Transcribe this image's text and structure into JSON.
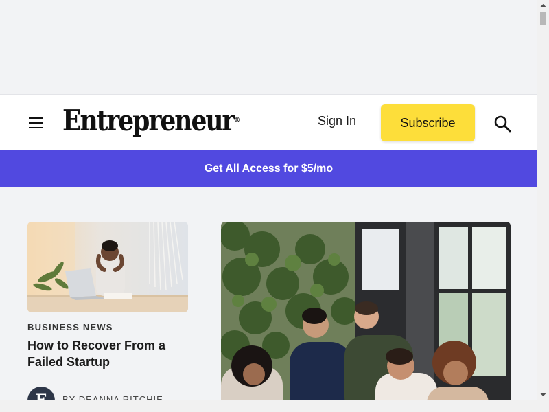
{
  "header": {
    "menu_icon": "hamburger-menu-icon",
    "logo": "Entrepreneur",
    "logo_mark": "®",
    "sign_in_label": "Sign In",
    "subscribe_label": "Subscribe",
    "search_icon": "search-icon"
  },
  "promo": {
    "text": "Get All Access for $5/mo",
    "background": "#5149e0"
  },
  "articles": [
    {
      "image": "woman-stressed-at-laptop-photo",
      "kicker": "BUSINESS NEWS",
      "headline": "How to Recover From a Failed Startup",
      "author_avatar": "E",
      "byline": "BY DEANNA RITCHIE"
    },
    {
      "image": "team-meeting-around-laptop-photo"
    }
  ],
  "colors": {
    "subscribe_button": "#fdde3a",
    "page_background": "#f2f3f5"
  }
}
